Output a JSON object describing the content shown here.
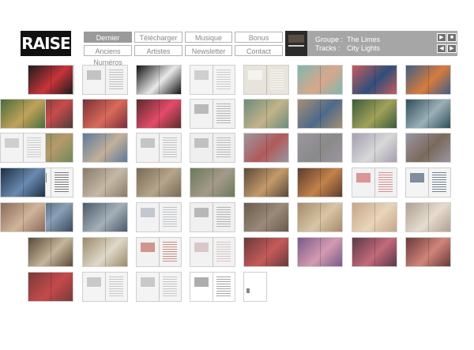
{
  "brand": {
    "logo_text": "RAISE"
  },
  "nav": {
    "items": [
      {
        "label": "Dernier Numéro",
        "active": true
      },
      {
        "label": "Télécharger",
        "active": false
      },
      {
        "label": "Musique",
        "active": false
      },
      {
        "label": "Bonus",
        "active": false
      },
      {
        "label": "Anciens Numéros",
        "active": false
      },
      {
        "label": "Artistes",
        "active": false
      },
      {
        "label": "Newsletter",
        "active": false
      },
      {
        "label": "Contact",
        "active": false
      }
    ]
  },
  "player": {
    "group_label": "Groupe :",
    "group_value": "The Limes",
    "tracks_label": "Tracks :",
    "tracks_value": "City Lights",
    "controls": [
      {
        "icon": "play-icon",
        "glyph": "▶"
      },
      {
        "icon": "stop-icon",
        "glyph": "■"
      },
      {
        "icon": "previous-icon",
        "glyph": "◀"
      },
      {
        "icon": "next-icon",
        "glyph": "▶"
      }
    ]
  },
  "pages": {
    "rows": [
      [
        {
          "style": "photo",
          "colors": [
            "#c9c3bd",
            "#7a4a3a"
          ]
        },
        {
          "style": "photo",
          "colors": [
            "#1c1c1c",
            "#c8343a"
          ]
        },
        {
          "style": "doc",
          "colors": [
            "#f3f3f3",
            "#9a9a9a"
          ]
        },
        {
          "style": "photo",
          "colors": [
            "#111111",
            "#e9e9e9"
          ]
        },
        {
          "style": "doc",
          "colors": [
            "#f4f4f4",
            "#b0b0b0"
          ]
        },
        {
          "style": "doc",
          "colors": [
            "#e8e4dc",
            "#ffffff"
          ]
        },
        {
          "style": "photo",
          "colors": [
            "#7fb7ad",
            "#d9a78c"
          ]
        },
        {
          "style": "photo",
          "colors": [
            "#c75c5c",
            "#2f4f7a"
          ]
        },
        {
          "style": "photo",
          "colors": [
            "#3e5f85",
            "#d77b3e"
          ]
        }
      ],
      [
        {
          "style": "photo",
          "colors": [
            "#4f3a3a",
            "#c94b4b"
          ]
        },
        {
          "style": "photo",
          "colors": [
            "#7a2f3a",
            "#d96a5a"
          ]
        },
        {
          "style": "photo",
          "colors": [
            "#5c2a2a",
            "#e34b6a"
          ]
        },
        {
          "style": "doc",
          "colors": [
            "#f2f2f2",
            "#8a8a8a"
          ]
        },
        {
          "style": "photo",
          "colors": [
            "#6c8c7a",
            "#c2b38a"
          ]
        },
        {
          "style": "photo",
          "colors": [
            "#a58f74",
            "#4d6a8a"
          ]
        },
        {
          "style": "photo",
          "colors": [
            "#3b5c3b",
            "#a1a15a"
          ]
        },
        {
          "style": "photo",
          "colors": [
            "#2f4f5a",
            "#9bb0b8"
          ]
        },
        {
          "style": "photo",
          "colors": [
            "#4a6c3a",
            "#c0a25a"
          ]
        }
      ],
      [
        {
          "style": "photo",
          "colors": [
            "#6c8a5a",
            "#b79a6a"
          ]
        },
        {
          "style": "photo",
          "colors": [
            "#5a7a9a",
            "#c3b09a"
          ]
        },
        {
          "style": "doc",
          "colors": [
            "#f2f2f2",
            "#a0a0a0"
          ]
        },
        {
          "style": "doc",
          "colors": [
            "#efefef",
            "#9a9a9a"
          ]
        },
        {
          "style": "photo",
          "colors": [
            "#9c95a0",
            "#b05a5a"
          ]
        },
        {
          "style": "photo",
          "colors": [
            "#9c95a0",
            "#8a8a8a"
          ]
        },
        {
          "style": "photo",
          "colors": [
            "#a59fb0",
            "#d8d8d8"
          ]
        },
        {
          "style": "photo",
          "colors": [
            "#9a94a5",
            "#7a6a5a"
          ]
        },
        {
          "style": "doc",
          "colors": [
            "#f3f3f3",
            "#b0b0b0"
          ]
        }
      ],
      [
        {
          "style": "doc",
          "colors": [
            "#f4f4f4",
            "#2a2a2a"
          ]
        },
        {
          "style": "photo",
          "colors": [
            "#8a7a6a",
            "#c5b9a5"
          ]
        },
        {
          "style": "photo",
          "colors": [
            "#7a6a55",
            "#b5a58a"
          ]
        },
        {
          "style": "photo",
          "colors": [
            "#6a7a5a",
            "#a59a8a"
          ]
        },
        {
          "style": "photo",
          "colors": [
            "#5a4a3a",
            "#c49a6a"
          ]
        },
        {
          "style": "photo",
          "colors": [
            "#5c3b2f",
            "#c3834a"
          ]
        },
        {
          "style": "doc",
          "colors": [
            "#f2f2f2",
            "#c84b4b"
          ]
        },
        {
          "style": "doc",
          "colors": [
            "#f4f4f4",
            "#1f3a5a"
          ]
        },
        {
          "style": "photo",
          "colors": [
            "#1e2f45",
            "#6a8ab0"
          ]
        }
      ],
      [
        {
          "style": "photo",
          "colors": [
            "#3a4a5a",
            "#8aa0b8"
          ]
        },
        {
          "style": "photo",
          "colors": [
            "#4a5a6a",
            "#a5b0b8"
          ]
        },
        {
          "style": "doc",
          "colors": [
            "#f2f2f2",
            "#9aa5b0"
          ]
        },
        {
          "style": "doc",
          "colors": [
            "#f0f0f0",
            "#8a8a8a"
          ]
        },
        {
          "style": "photo",
          "colors": [
            "#6a5a4a",
            "#9a8a7a"
          ]
        },
        {
          "style": "photo",
          "colors": [
            "#a58a6a",
            "#d8c5a5"
          ]
        },
        {
          "style": "photo",
          "colors": [
            "#c5a58a",
            "#e8d5b9"
          ]
        },
        {
          "style": "photo",
          "colors": [
            "#b0a090",
            "#e5dccf"
          ]
        },
        {
          "style": "photo",
          "colors": [
            "#8a6a5a",
            "#d0b59a"
          ]
        }
      ],
      [
        {
          "style": "photo",
          "colors": [
            "#5a4a3a",
            "#c5b59a"
          ]
        },
        {
          "style": "photo",
          "colors": [
            "#9a8a6a",
            "#e0d9c9"
          ]
        },
        {
          "style": "doc",
          "colors": [
            "#f2f2f2",
            "#b04a3a"
          ]
        },
        {
          "style": "doc",
          "colors": [
            "#f2f2f2",
            "#c5a5a5"
          ]
        },
        {
          "style": "photo",
          "colors": [
            "#6a3a3a",
            "#c55a5a"
          ]
        },
        {
          "style": "photo",
          "colors": [
            "#7a5a8a",
            "#d59ab0"
          ]
        },
        {
          "style": "photo",
          "colors": [
            "#5a3a4a",
            "#c26a7a"
          ]
        },
        {
          "style": "photo",
          "colors": [
            "#6a3a3a",
            "#d0857a"
          ]
        }
      ],
      [
        {
          "style": "photo",
          "colors": [
            "#7a3a3a",
            "#c54a4a"
          ]
        },
        {
          "style": "doc",
          "colors": [
            "#f4f4f4",
            "#a5a5a5"
          ]
        },
        {
          "style": "doc",
          "colors": [
            "#f4f4f4",
            "#a5a5a5"
          ]
        },
        {
          "style": "doc",
          "colors": [
            "#ffffff",
            "#6a6a6a"
          ]
        },
        {
          "style": "cover",
          "colors": [
            "#ffffff",
            "#888888"
          ]
        }
      ]
    ]
  }
}
